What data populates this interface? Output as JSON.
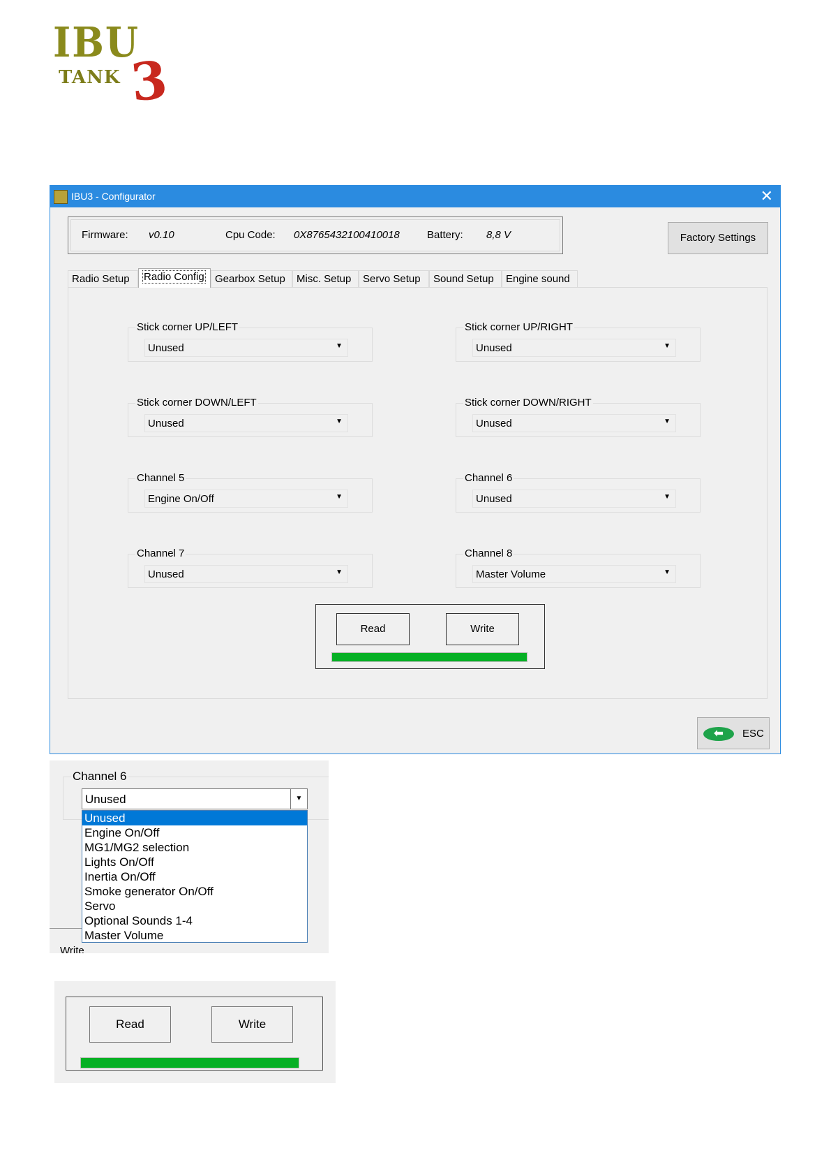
{
  "logo": {
    "line1": "IBU",
    "line2": "TANK",
    "line3": "3"
  },
  "window": {
    "title": "IBU3 - Configurator",
    "close_glyph": "✕"
  },
  "info": {
    "firmware_label": "Firmware:",
    "firmware_value": "v0.10",
    "cpu_label": "Cpu Code:",
    "cpu_value": "0X8765432100410018",
    "battery_label": "Battery:",
    "battery_value": "8,8 V"
  },
  "factory_button": "Factory Settings",
  "tabs": [
    "Radio Setup",
    "Radio Config",
    "Gearbox Setup",
    "Misc. Setup",
    "Servo Setup",
    "Sound Setup",
    "Engine sound"
  ],
  "active_tab": "Radio Config",
  "groups": [
    {
      "label": "Stick corner UP/LEFT",
      "value": "Unused"
    },
    {
      "label": "Stick corner UP/RIGHT",
      "value": "Unused"
    },
    {
      "label": "Stick corner DOWN/LEFT",
      "value": "Unused"
    },
    {
      "label": "Stick corner DOWN/RIGHT",
      "value": "Unused"
    },
    {
      "label": "Channel 5",
      "value": "Engine On/Off"
    },
    {
      "label": "Channel 6",
      "value": "Unused"
    },
    {
      "label": "Channel 7",
      "value": "Unused"
    },
    {
      "label": "Channel 8",
      "value": "Master Volume"
    }
  ],
  "read_button": "Read",
  "write_button": "Write",
  "progress": 1.0,
  "esc_button": "ESC",
  "dropdown_zoom": {
    "label": "Channel 6",
    "value": "Unused",
    "options": [
      "Unused",
      "Engine On/Off",
      "MG1/MG2 selection",
      "Lights On/Off",
      "Inertia On/Off",
      "Smoke generator On/Off",
      "Servo",
      "Optional Sounds 1-4",
      "Master Volume"
    ],
    "selected_index": 0,
    "partial_text": "Write"
  },
  "rw_zoom": {
    "read": "Read",
    "write": "Write",
    "progress": 1.0
  },
  "colors": {
    "titlebar": "#2b8be0",
    "progress": "#06b025",
    "selection": "#0078d7",
    "logo_olive": "#8a8a1c",
    "logo_red": "#c8281e"
  },
  "icons": {
    "arrow": "chevron-down-icon",
    "esc": "back-arrow-icon",
    "app": "ibu-app-icon"
  }
}
